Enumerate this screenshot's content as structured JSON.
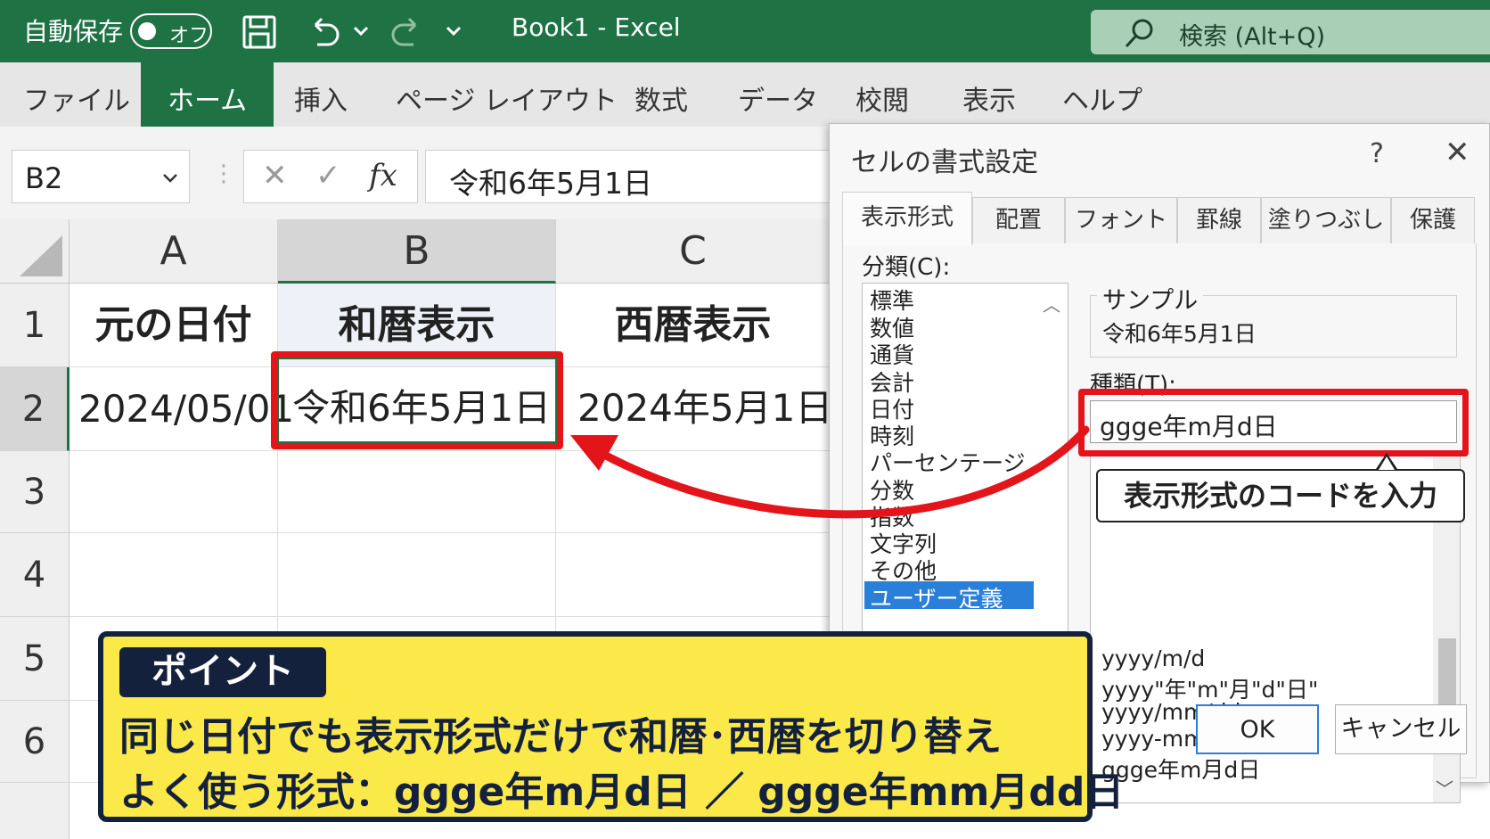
{
  "titlebar": {
    "autosave_label": "自動保存",
    "autosave_state": "オフ",
    "title": "Book1  -  Excel",
    "search_placeholder": "検索 (Alt+Q)"
  },
  "ribbon_tabs": [
    "ファイル",
    "ホーム",
    "挿入",
    "ページ レイアウト",
    "数式",
    "データ",
    "校閲",
    "表示",
    "ヘルプ"
  ],
  "active_tab": "ホーム",
  "formula_bar": {
    "name_box": "B2",
    "cancel_glyph": "✕",
    "enter_glyph": "✓",
    "fx_glyph": "fx",
    "value": "令和6年5月1日"
  },
  "sheet": {
    "columns": [
      "A",
      "B",
      "C"
    ],
    "rows": [
      "1",
      "2",
      "3",
      "4",
      "5",
      "6"
    ],
    "selected_cell": "B2",
    "cells": {
      "A1": "元の日付",
      "B1": "和暦表示",
      "C1": "西暦表示",
      "A2": "2024/05/01",
      "B2": "令和6年5月1日",
      "C2": "2024年5月1日"
    }
  },
  "dialog": {
    "title": "セルの書式設定",
    "help": "?",
    "close": "✕",
    "tabs": [
      "表示形式",
      "配置",
      "フォント",
      "罫線",
      "塗りつぶし",
      "保護"
    ],
    "active_tab": "表示形式",
    "category_label": "分類(C):",
    "categories": [
      "標準",
      "数値",
      "通貨",
      "会計",
      "日付",
      "時刻",
      "パーセンテージ",
      "分数",
      "指数",
      "文字列",
      "その他",
      "ユーザー定義"
    ],
    "selected_category": "ユーザー定義",
    "sample_label": "サンプル",
    "sample_value": "令和6年5月1日",
    "type_label": "種類(T):",
    "type_value": "ggge年m月d日",
    "format_list": [
      "yyyy/m/d",
      "yyyy\"年\"m\"月\"d\"日\"",
      "yyyy/mm/dd",
      "yyyy-mm-dd",
      "ggge年m月d日"
    ],
    "ok": "OK",
    "cancel": "キャンセル"
  },
  "annotations": {
    "callout": "表示形式のコードを入力",
    "point_badge": "ポイント",
    "point_line1": "同じ日付でも表示形式だけで和暦･西暦を切り替え",
    "point_line2": "よく使う形式：ggge年m月d日 ／ ggge年mm月dd日",
    "accent_red": "#e3151b",
    "point_bg": "#fbe94a",
    "point_navy": "#14213d"
  }
}
